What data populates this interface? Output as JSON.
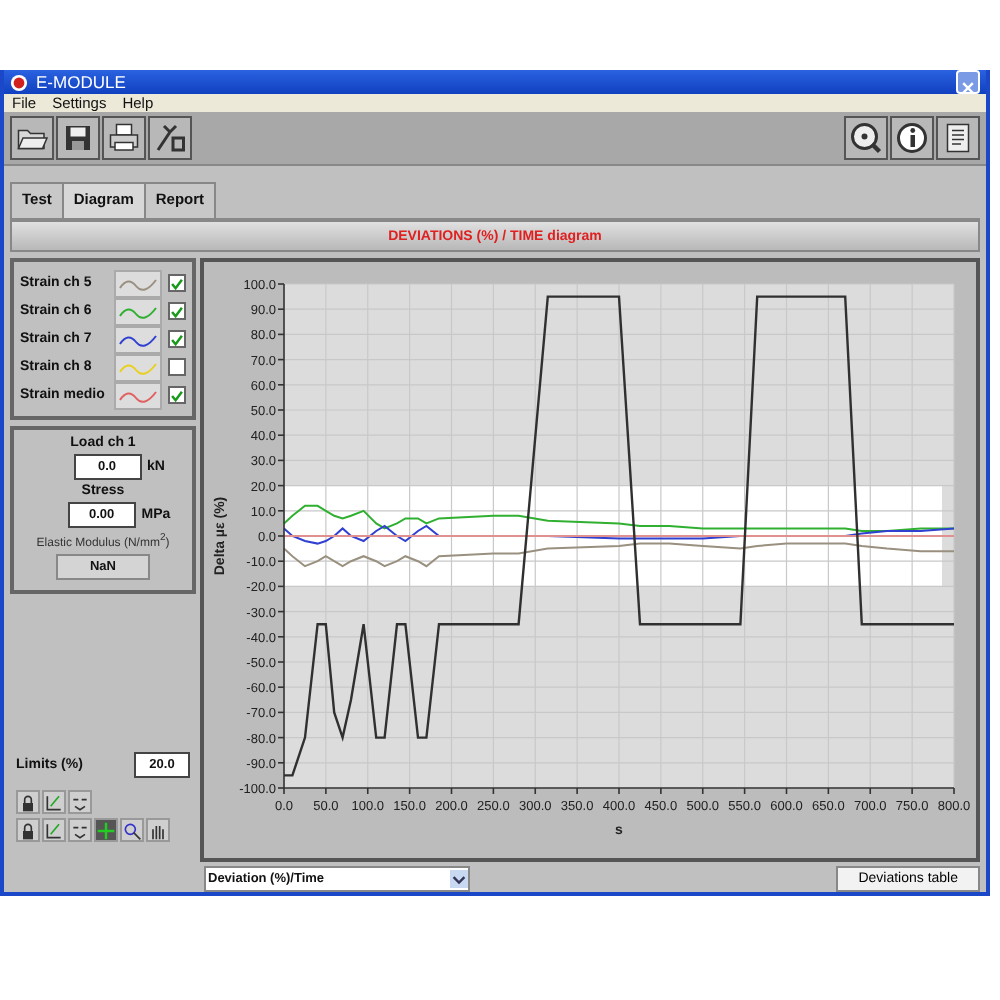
{
  "window": {
    "title": "E-MODULE"
  },
  "menu": [
    "File",
    "Settings",
    "Help"
  ],
  "tabs": [
    {
      "label": "Test",
      "selected": false
    },
    {
      "label": "Diagram",
      "selected": true
    },
    {
      "label": "Report",
      "selected": false
    }
  ],
  "diagram_title": "DEVIATIONS (%) / TIME diagram",
  "legend": [
    {
      "label": "Strain ch 5",
      "color": "#9a9080",
      "checked": true
    },
    {
      "label": "Strain ch 6",
      "color": "#30b030",
      "checked": true
    },
    {
      "label": "Strain ch 7",
      "color": "#3040d0",
      "checked": true
    },
    {
      "label": "Strain ch 8",
      "color": "#e8d020",
      "checked": false
    },
    {
      "label": "Strain medio",
      "color": "#e06060",
      "checked": true
    }
  ],
  "load": {
    "label": "Load ch 1",
    "value": "0.0",
    "unit": "kN"
  },
  "stress": {
    "label": "Stress",
    "value": "0.00",
    "unit": "MPa"
  },
  "elastic_modulus": {
    "label": "Elastic Modulus (N/mm$^{2}$)",
    "value": "NaN"
  },
  "limits": {
    "label": "Limits (%)",
    "value": "20.0"
  },
  "chart_data": {
    "type": "line",
    "xlabel": "s",
    "ylabel": "Delta µε (%)",
    "xlim": [
      0,
      800
    ],
    "ylim": [
      -100,
      100
    ],
    "grid": true,
    "xticks": [
      {
        "value": 0,
        "label": "0.0"
      },
      {
        "value": 50,
        "label": "50.0"
      },
      {
        "value": 100,
        "label": "100.0"
      },
      {
        "value": 150,
        "label": "150.0"
      },
      {
        "value": 200,
        "label": "200.0"
      },
      {
        "value": 250,
        "label": "250.0"
      },
      {
        "value": 300,
        "label": "300.0"
      },
      {
        "value": 350,
        "label": "350.0"
      },
      {
        "value": 400,
        "label": "400.0"
      },
      {
        "value": 450,
        "label": "450.0"
      },
      {
        "value": 500,
        "label": "500.0"
      },
      {
        "value": 550,
        "label": "550.0"
      },
      {
        "value": 600,
        "label": "600.0"
      },
      {
        "value": 650,
        "label": "650.0"
      },
      {
        "value": 700,
        "label": "700.0"
      },
      {
        "value": 750,
        "label": "750.0"
      },
      {
        "value": 800,
        "label": "800.0"
      }
    ],
    "yticks": [
      {
        "value": -100,
        "label": "-100.0"
      },
      {
        "value": -90,
        "label": "-90.0"
      },
      {
        "value": -80,
        "label": "-80.0"
      },
      {
        "value": -70,
        "label": "-70.0"
      },
      {
        "value": -60,
        "label": "-60.0"
      },
      {
        "value": -50,
        "label": "-50.0"
      },
      {
        "value": -40,
        "label": "-40.0"
      },
      {
        "value": -30,
        "label": "-30.0"
      },
      {
        "value": -20,
        "label": "-20.0"
      },
      {
        "value": -10,
        "label": "-10.0"
      },
      {
        "value": 0,
        "label": "0.0"
      },
      {
        "value": 10,
        "label": "10.0"
      },
      {
        "value": 20,
        "label": "20.0"
      },
      {
        "value": 30,
        "label": "30.0"
      },
      {
        "value": 40,
        "label": "40.0"
      },
      {
        "value": 50,
        "label": "50.0"
      },
      {
        "value": 60,
        "label": "60.0"
      },
      {
        "value": 70,
        "label": "70.0"
      },
      {
        "value": 80,
        "label": "80.0"
      },
      {
        "value": 90,
        "label": "90.0"
      },
      {
        "value": 100,
        "label": "100.0"
      }
    ],
    "x": [
      0,
      10,
      25,
      40,
      50,
      60,
      70,
      80,
      95,
      110,
      120,
      135,
      145,
      160,
      170,
      185,
      250,
      280,
      315,
      400,
      425,
      460,
      500,
      545,
      565,
      600,
      640,
      670,
      690,
      720,
      760,
      800
    ],
    "series": [
      {
        "color": "#9a9080",
        "values": [
          -5,
          -8,
          -12,
          -10,
          -8,
          -10,
          -12,
          -10,
          -8,
          -10,
          -12,
          -10,
          -8,
          -10,
          -12,
          -8,
          -7,
          -7,
          -5,
          -4,
          -3,
          -3,
          -4,
          -5,
          -4,
          -3,
          -3,
          -3,
          -4,
          -5,
          -6,
          -6
        ]
      },
      {
        "color": "#30b030",
        "values": [
          5,
          8,
          12,
          12,
          10,
          8,
          7,
          8,
          10,
          5,
          3,
          5,
          7,
          7,
          5,
          7,
          8,
          8,
          6,
          5,
          4,
          4,
          3,
          3,
          3,
          3,
          3,
          3,
          2,
          2,
          3,
          3
        ]
      },
      {
        "color": "#3040d0",
        "values": [
          3,
          0,
          -2,
          -3,
          -2,
          0,
          3,
          0,
          -2,
          2,
          4,
          0,
          -2,
          2,
          4,
          0,
          0,
          0,
          0,
          -1,
          -1,
          -1,
          -1,
          0,
          0,
          0,
          0,
          0,
          1,
          2,
          2,
          3
        ]
      },
      {
        "color": "#e09090",
        "values": [
          0,
          0,
          0,
          0,
          0,
          0,
          0,
          0,
          0,
          0,
          0,
          0,
          0,
          0,
          0,
          0,
          0,
          0,
          0,
          0,
          0,
          0,
          0,
          0,
          0,
          0,
          0,
          0,
          0,
          0,
          0,
          0
        ]
      },
      {
        "color": "#303030",
        "values": [
          -95,
          -95,
          -80,
          -35,
          -35,
          -70,
          -80,
          -65,
          -35,
          -80,
          -80,
          -35,
          -35,
          -80,
          -80,
          -35,
          -35,
          -35,
          95,
          95,
          -35,
          -35,
          -35,
          -35,
          95,
          95,
          95,
          95,
          -35,
          -35,
          -35,
          -35
        ]
      }
    ],
    "bands": [
      {
        "axis": "y",
        "from": -20,
        "to": 20,
        "color": "#ffffff"
      }
    ]
  },
  "view_select": {
    "value": "Deviation (%)/Time"
  },
  "deviations_button": "Deviations table"
}
